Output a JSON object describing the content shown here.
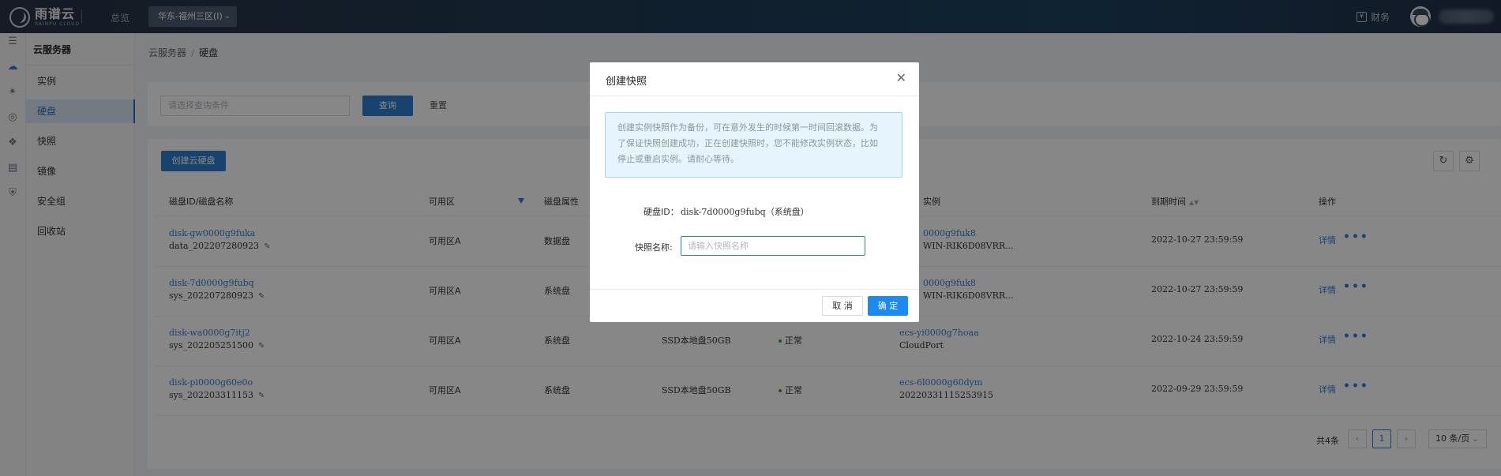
{
  "topbar": {
    "logo_name": "雨谱云",
    "logo_sub": "RAINPU CLOUD",
    "overview": "总览",
    "region": "华东-福州三区(I)",
    "finance": "财务"
  },
  "sidebar": {
    "title": "云服务器",
    "items": [
      {
        "label": "实例",
        "active": false
      },
      {
        "label": "硬盘",
        "active": true
      },
      {
        "label": "快照",
        "active": false
      },
      {
        "label": "镜像",
        "active": false
      },
      {
        "label": "安全组",
        "active": false
      },
      {
        "label": "回收站",
        "active": false
      }
    ]
  },
  "breadcrumb": {
    "parent": "云服务器",
    "separator": "/",
    "current": "硬盘"
  },
  "search": {
    "placeholder": "请选择查询条件",
    "query": "查询",
    "reset": "重置"
  },
  "table": {
    "create_button": "创建云硬盘",
    "columns": {
      "id_name": "磁盘ID/磁盘名称",
      "zone": "可用区",
      "attr": "磁盘属性",
      "instance": "实例",
      "expire": "到期时间",
      "ops": "操作"
    },
    "rows": [
      {
        "id": "disk-gw0000g9fuka",
        "name": "data_202207280923",
        "zone": "可用区A",
        "attr": "数据盘",
        "spec": "",
        "status": "",
        "instance_id": "ecs-i0000g9fuk8",
        "instance_id_visible": "0000g9fuk8",
        "instance_name": "WIN-RIK6D08VRR...",
        "expire": "2022-10-27 23:59:59",
        "detail": "详情",
        "more": "•••"
      },
      {
        "id": "disk-7d0000g9fubq",
        "name": "sys_202207280923",
        "zone": "可用区A",
        "attr": "系统盘",
        "spec": "",
        "status": "",
        "instance_id": "ecs-i0000g9fuk8",
        "instance_id_visible": "0000g9fuk8",
        "instance_name": "WIN-RIK6D08VRR...",
        "expire": "2022-10-27 23:59:59",
        "detail": "详情",
        "more": "•••"
      },
      {
        "id": "disk-wa0000g7itj2",
        "name": "sys_202205251500",
        "zone": "可用区A",
        "attr": "系统盘",
        "spec": "SSD本地盘50GB",
        "status": "正常",
        "instance_id": "ecs-yi0000g7hoaa",
        "instance_id_visible": "ecs-yi0000g7hoaa",
        "instance_name": "CloudPort",
        "expire": "2022-10-24 23:59:59",
        "detail": "详情",
        "more": "•••"
      },
      {
        "id": "disk-pi0000g60e0o",
        "name": "sys_202203311153",
        "zone": "可用区A",
        "attr": "系统盘",
        "spec": "SSD本地盘50GB",
        "status": "正常",
        "instance_id": "ecs-6l0000g60dym",
        "instance_id_visible": "ecs-6l0000g60dym",
        "instance_name": "20220331115253915",
        "expire": "2022-09-29 23:59:59",
        "detail": "详情",
        "more": "•••"
      }
    ],
    "pagination": {
      "total": "共4条",
      "page": "1",
      "page_size": "10 条/页"
    }
  },
  "modal": {
    "title": "创建快照",
    "notice_lines": [
      "创建实例快照作为备份，可在意外发生的时候第一时间回滚数据。为",
      "了保证快照创建成功，正在创建快照时，您不能修改实例状态，比如",
      "停止或重启实例。请耐心等待。"
    ],
    "disk_id_label": "硬盘ID：",
    "disk_id_value": "disk-7d0000g9fubq（系统盘）",
    "name_label": "快照名称:",
    "name_placeholder": "请输入快照名称",
    "cancel": "取 消",
    "ok": "确 定"
  },
  "colors": {
    "primary": "#2f7fd1",
    "ok_button": "#1a8af5",
    "status_ok": "#2ea843",
    "notice_bg": "#e6f5fd"
  }
}
